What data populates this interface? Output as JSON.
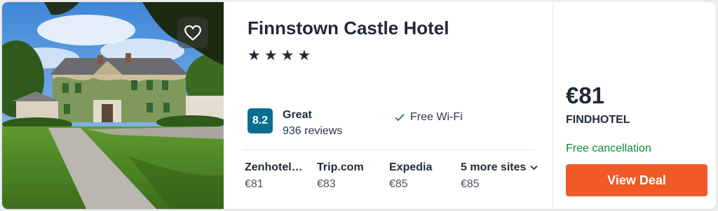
{
  "hotel": {
    "name": "Finnstown Castle Hotel",
    "stars": "★★★★",
    "rating": {
      "score": "8.2",
      "label": "Great",
      "reviews": "936 reviews",
      "badge_color": "#0a6f8f"
    },
    "amenity": "Free Wi-Fi",
    "amenity_icon": "checkmark-icon",
    "favorite_icon": "heart-icon"
  },
  "providers": [
    {
      "name": "Zenhotel…",
      "price": "€81"
    },
    {
      "name": "Trip.com",
      "price": "€83"
    },
    {
      "name": "Expedia",
      "price": "€85"
    }
  ],
  "more_sites": {
    "label": "5 more sites",
    "price": "€85",
    "icon": "chevron-down-icon"
  },
  "deal": {
    "price": "€81",
    "vendor": "FINDHOTEL",
    "cancellation": "Free cancellation",
    "button_label": "View Deal",
    "button_color": "#ef5a28",
    "cancellation_color": "#108a34"
  }
}
